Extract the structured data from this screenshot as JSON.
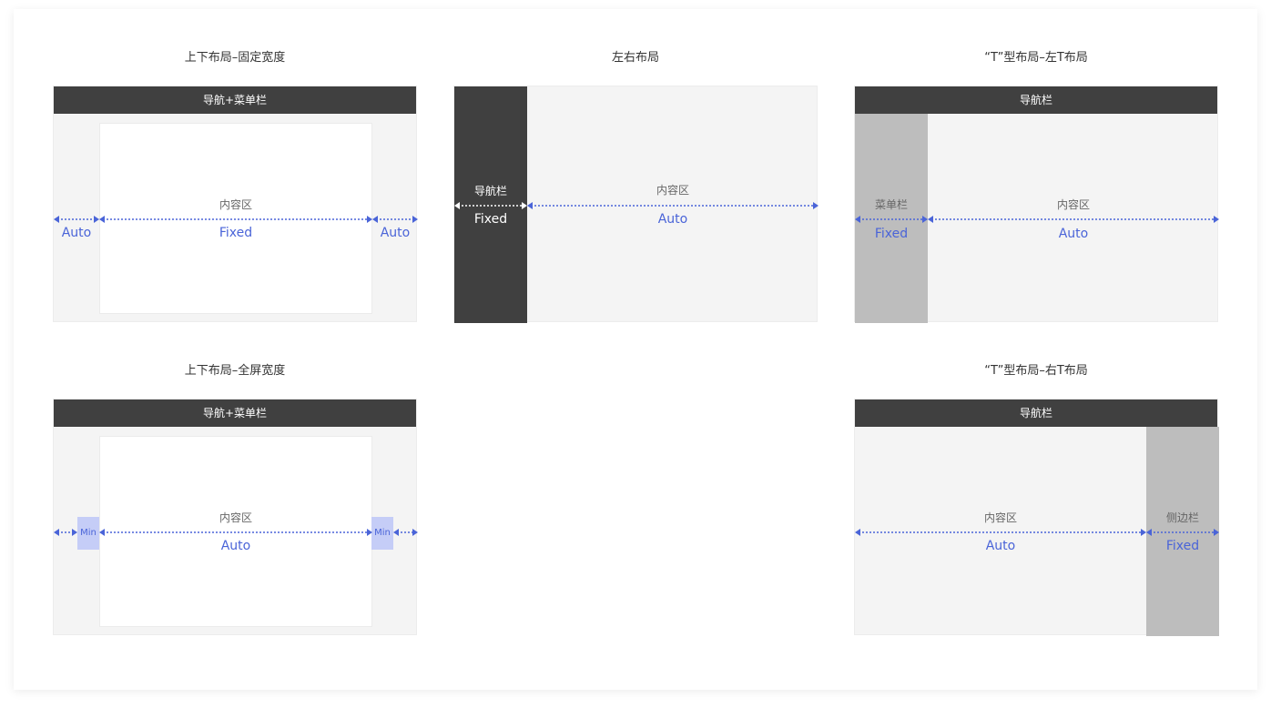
{
  "layouts": {
    "fixed_width": {
      "title": "上下布局–固定宽度",
      "nav": "导航+菜单栏",
      "content": "内容区",
      "left_value": "Auto",
      "center_value": "Fixed",
      "right_value": "Auto"
    },
    "left_right": {
      "title": "左右布局",
      "nav": "导航栏",
      "nav_value": "Fixed",
      "content": "内容区",
      "content_value": "Auto"
    },
    "t_left": {
      "title": "“T”型布局–左T布局",
      "nav": "导航栏",
      "menu": "菜单栏",
      "menu_value": "Fixed",
      "content": "内容区",
      "content_value": "Auto"
    },
    "full_width": {
      "title": "上下布局–全屏宽度",
      "nav": "导航+菜单栏",
      "content": "内容区",
      "content_value": "Auto",
      "min_left": "Min",
      "min_right": "Min"
    },
    "t_right": {
      "title": "“T”型布局–右T布局",
      "nav": "导航栏",
      "content": "内容区",
      "content_value": "Auto",
      "sidebar": "侧边栏",
      "sidebar_value": "Fixed"
    }
  },
  "colors": {
    "accent": "#4a64d8",
    "dark": "#404040",
    "panel": "#f4f4f4",
    "side": "#bdbdbd",
    "min": "#c5cdf7"
  }
}
